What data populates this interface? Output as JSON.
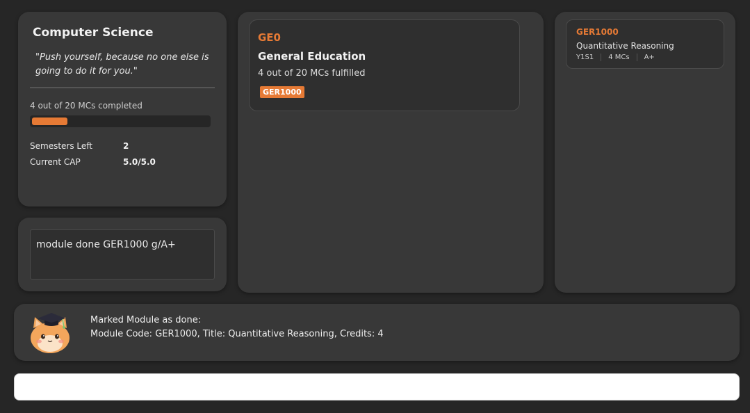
{
  "profile": {
    "title": "Computer Science",
    "quote": "\"Push yourself, because no one else is going to do it for you.\"",
    "progress_label": "4 out of 20 MCs completed",
    "progress_fraction": 0.2,
    "stats": [
      {
        "label": "Semesters Left",
        "value": "2"
      },
      {
        "label": "Current CAP",
        "value": "5.0/5.0"
      }
    ]
  },
  "command_echo": {
    "text": "module done GER1000 g/A+"
  },
  "requirements": [
    {
      "code": "GE0",
      "name": "General Education",
      "summary": "4 out of 20 MCs fulfilled",
      "modules": [
        "GER1000"
      ]
    }
  ],
  "modules": [
    {
      "code": "GER1000",
      "title": "Quantitative Reasoning",
      "semester": "Y1S1",
      "credits": "4 MCs",
      "grade": "A+"
    }
  ],
  "result": {
    "line1": "Marked Module as done:",
    "line2": "Module Code: GER1000, Title: Quantitative Reasoning, Credits: 4",
    "mascot_icon": "graduate-cat-icon"
  },
  "command_input": {
    "value": "",
    "placeholder": ""
  },
  "colors": {
    "accent": "#e67a35",
    "background": "#262626",
    "panel": "#383838"
  }
}
